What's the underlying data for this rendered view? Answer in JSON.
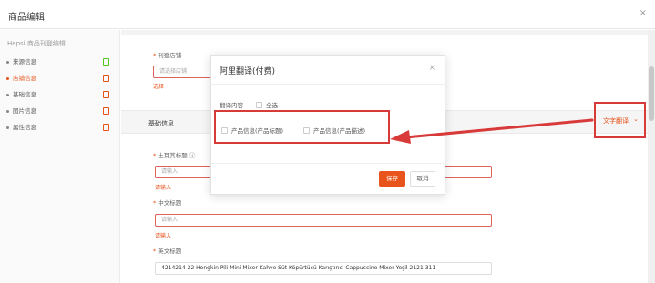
{
  "window": {
    "title": "商品编辑",
    "close_glyph": "×"
  },
  "sidebar": {
    "header": "Hepsi 商品刊登编辑",
    "items": [
      {
        "label": "来源信息",
        "status": "ok"
      },
      {
        "label": "店铺信息",
        "status": "error",
        "active": true
      },
      {
        "label": "基础信息",
        "status": "error"
      },
      {
        "label": "图片信息",
        "status": "error"
      },
      {
        "label": "属性信息",
        "status": "error"
      }
    ]
  },
  "store": {
    "label": "刊登店铺",
    "placeholder": "请选择店铺",
    "error": "选择"
  },
  "basic": {
    "section_title": "基础信息",
    "translate_label": "文字翻译",
    "turkish_title_label": "土耳其标题",
    "turkish_title_placeholder": "请输入",
    "turkish_title_error": "请输入",
    "chinese_title_label": "中文标题",
    "chinese_title_placeholder": "请输入",
    "chinese_title_error": "请输入",
    "english_title_label": "英文标题",
    "english_title_value": "4214214 22 Hongkin Pili Mini Mixer Kahve Süt Köpürtücü Karıştırıcı Cappuccino Mixer Yeşil 2121 311"
  },
  "modal": {
    "title": "阿里翻译(付费)",
    "close_glyph": "×",
    "content_label": "翻译内容",
    "select_all": "全选",
    "options": [
      "产品信息(产品标题)",
      "产品信息(产品描述)"
    ],
    "save": "保存",
    "cancel": "取消"
  },
  "colors": {
    "accent": "#e8541b",
    "annotation": "#d83a3a",
    "ok": "#52c41a"
  }
}
